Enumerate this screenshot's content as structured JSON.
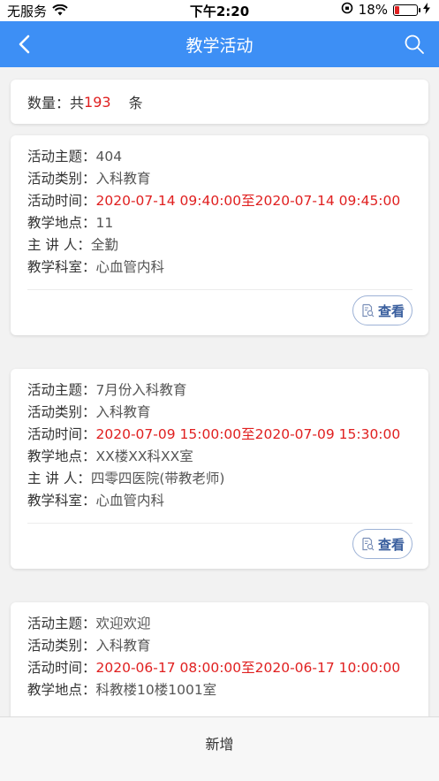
{
  "status_bar": {
    "carrier": "无服务",
    "time": "下午2:20",
    "battery_percent": "18%",
    "battery_level": 0.18
  },
  "nav": {
    "title": "教学活动"
  },
  "summary": {
    "label": "数量：共",
    "count": "193",
    "unit": "条"
  },
  "labels": {
    "topic": "活动主题：",
    "category": "活动类别：",
    "time": "活动时间：",
    "location": "教学地点：",
    "speaker": "主 讲 人：",
    "department": "教学科室："
  },
  "activities": [
    {
      "topic": "404",
      "category": "入科教育",
      "time": "2020-07-14 09:40:00至2020-07-14 09:45:00",
      "location": "11",
      "speaker": "全勤",
      "department": "心血管内科",
      "view_label": "查看"
    },
    {
      "topic": "7月份入科教育",
      "category": "入科教育",
      "time": "2020-07-09 15:00:00至2020-07-09 15:30:00",
      "location": "XX楼XX科XX室",
      "speaker": "四零四医院(带教老师)",
      "department": "心血管内科",
      "view_label": "查看"
    },
    {
      "topic": "欢迎欢迎",
      "category": "入科教育",
      "time": "2020-06-17 08:00:00至2020-06-17 10:00:00",
      "location": "科教楼10楼1001室"
    }
  ],
  "bottom": {
    "add_label": "新增"
  },
  "colors": {
    "nav_bg": "#3d8ff5",
    "highlight_red": "#e02020"
  }
}
